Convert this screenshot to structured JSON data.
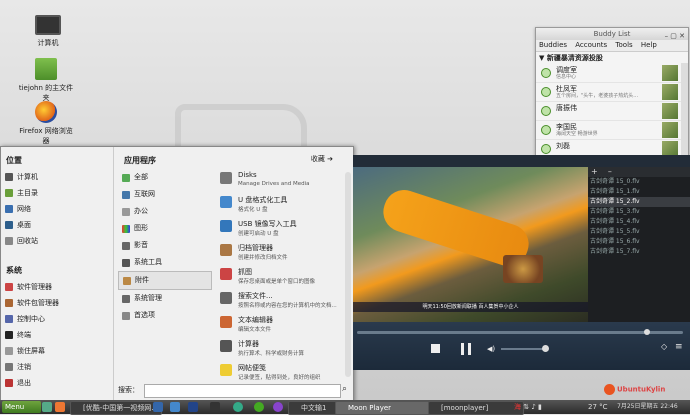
{
  "desktop": {
    "icons": [
      {
        "label": "计算机"
      },
      {
        "label": "tiejohn 的主文件夹"
      },
      {
        "label": "Firefox 网络浏览器"
      }
    ]
  },
  "buddy_list": {
    "title": "Buddy List",
    "menu": [
      "Buddies",
      "Accounts",
      "Tools",
      "Help"
    ],
    "group": "新疆暴清资源投股",
    "buddies": [
      {
        "name": "调度室",
        "status": "信息中心"
      },
      {
        "name": "杜凤军",
        "status": "五个房间，\"头牛，老婆孩子热炕头..."
      },
      {
        "name": "唐振伟",
        "status": ""
      },
      {
        "name": "李国民",
        "status": "海阔天空 畅游世界"
      },
      {
        "name": "刘磊",
        "status": ""
      }
    ]
  },
  "start_menu": {
    "places_title": "位置",
    "places": [
      "计算机",
      "主目录",
      "网络",
      "桌面",
      "回收站"
    ],
    "system_title": "系统",
    "system": [
      "软件管理器",
      "软件包管理器",
      "控制中心",
      "终端",
      "锁住屏幕",
      "注销",
      "退出"
    ],
    "apps_title": "应用程序",
    "favorites": "收藏",
    "categories": [
      "全部",
      "互联网",
      "办公",
      "图形",
      "影音",
      "系统工具",
      "附件",
      "系统管理",
      "首选项"
    ],
    "selected_category": "附件",
    "apps": [
      {
        "name": "Disks",
        "desc": "Manage Drives and Media"
      },
      {
        "name": "U 盘格式化工具",
        "desc": "格式化 U 盘"
      },
      {
        "name": "USB 镜像写入工具",
        "desc": "创建可启动 U 盘"
      },
      {
        "name": "归档管理器",
        "desc": "创建并修改归档文件"
      },
      {
        "name": "抓图",
        "desc": "保存您桌面或是单个窗口的图像"
      },
      {
        "name": "搜索文件...",
        "desc": "按照名称或内容在您的计算机中的文档..."
      },
      {
        "name": "文本编辑器",
        "desc": "编辑文本文件"
      },
      {
        "name": "计算器",
        "desc": "执行算术、科学或财务计算"
      },
      {
        "name": "网帖便笺",
        "desc": "记录便签，贴得到处，良好的组织"
      }
    ],
    "search_label": "搜索："
  },
  "player": {
    "playlist_buttons": [
      "+",
      "–"
    ],
    "playlist": [
      "古剑奇谭 15_0.flv",
      "古剑奇谭 15_1.flv",
      "古剑奇谭 15_2.flv",
      "古剑奇谭 15_3.flv",
      "古剑奇谭 15_4.flv",
      "古剑奇谭 15_5.flv",
      "古剑奇谭 15_6.flv",
      "古剑奇谭 15_7.flv"
    ],
    "selected_index": 2,
    "ticker": "明天11:50回放新闻联播  百人集贺中小企人",
    "seek_progress": 0.88,
    "volume": 0.9
  },
  "badge": "UbuntuKylin",
  "taskbar": {
    "menu_label": "Menu",
    "windows": [
      "[优酷-中国第一视频网...",
      "",
      "",
      "中文输1",
      "Moon Player",
      "[moonplayer]"
    ],
    "active_window": 4,
    "tray": {
      "temp": "27 °C",
      "datetime": "7月25日星期五 22:46"
    }
  }
}
